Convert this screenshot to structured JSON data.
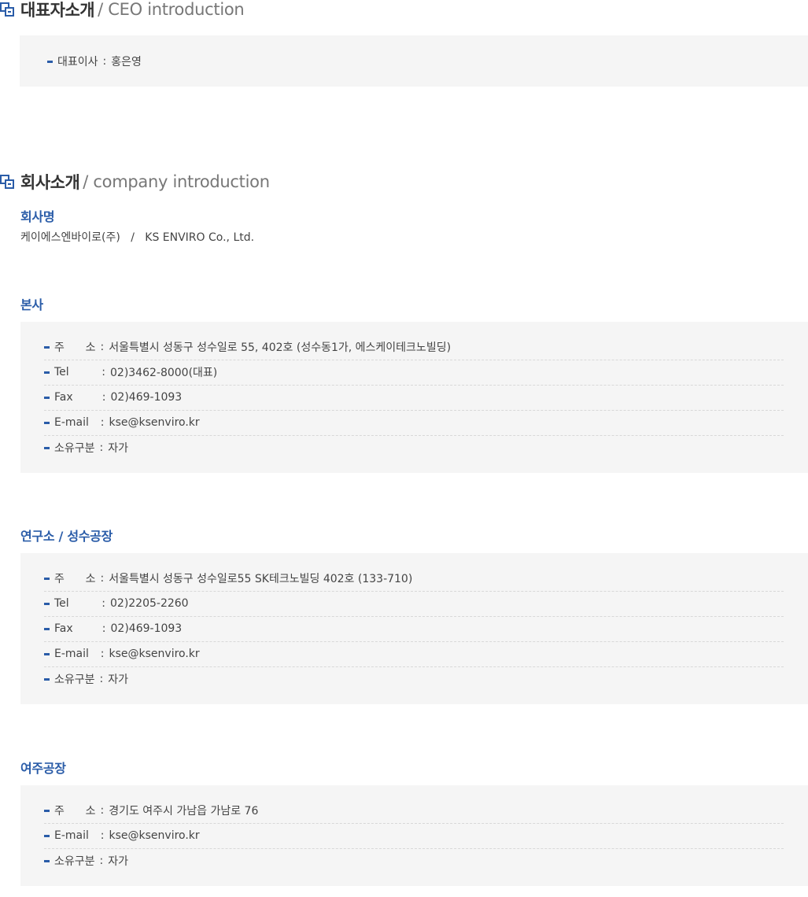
{
  "ceo_section": {
    "title_ko": "대표자소개",
    "title_en": "/ CEO introduction",
    "label": "대표이사",
    "value": "홍은영"
  },
  "company_section": {
    "title_ko": "회사소개",
    "title_en": "/ company introduction",
    "name_title": "회사명",
    "name_value": "케이에스엔바이로(주)   /   KS ENVIRO Co., Ltd."
  },
  "headquarters": {
    "title": "본사",
    "rows": [
      {
        "label": "주      소",
        "value": "서울특별시 성동구 성수일로 55, 402호 (성수동1가, 에스케이테크노빌딩)"
      },
      {
        "label": "Tel        ",
        "value": "02)3462-8000(대표)"
      },
      {
        "label": "Fax       ",
        "value": "02)469-1093"
      },
      {
        "label": "E-mail  ",
        "value": "kse@ksenviro.kr"
      },
      {
        "label": "소유구분",
        "value": "자가"
      }
    ]
  },
  "research": {
    "title": "연구소 / 성수공장",
    "rows": [
      {
        "label": "주      소",
        "value": "서울특별시 성동구 성수일로55 SK테크노빌딩 402호 (133-710)"
      },
      {
        "label": "Tel        ",
        "value": "02)2205-2260"
      },
      {
        "label": "Fax       ",
        "value": "02)469-1093"
      },
      {
        "label": "E-mail  ",
        "value": "kse@ksenviro.kr"
      },
      {
        "label": "소유구분",
        "value": "자가"
      }
    ]
  },
  "yeoju": {
    "title": "여주공장",
    "rows": [
      {
        "label": "주      소",
        "value": "경기도 여주시 가남읍 가남로 76"
      },
      {
        "label": "E-mail  ",
        "value": "kse@ksenviro.kr"
      },
      {
        "label": "소유구분",
        "value": "자가"
      }
    ]
  },
  "colon": ":",
  "colors": {
    "accent": "#2a5ca8",
    "box_bg": "#f5f5f5"
  },
  "icons": {
    "section_icon": "section-bullet-icon"
  }
}
